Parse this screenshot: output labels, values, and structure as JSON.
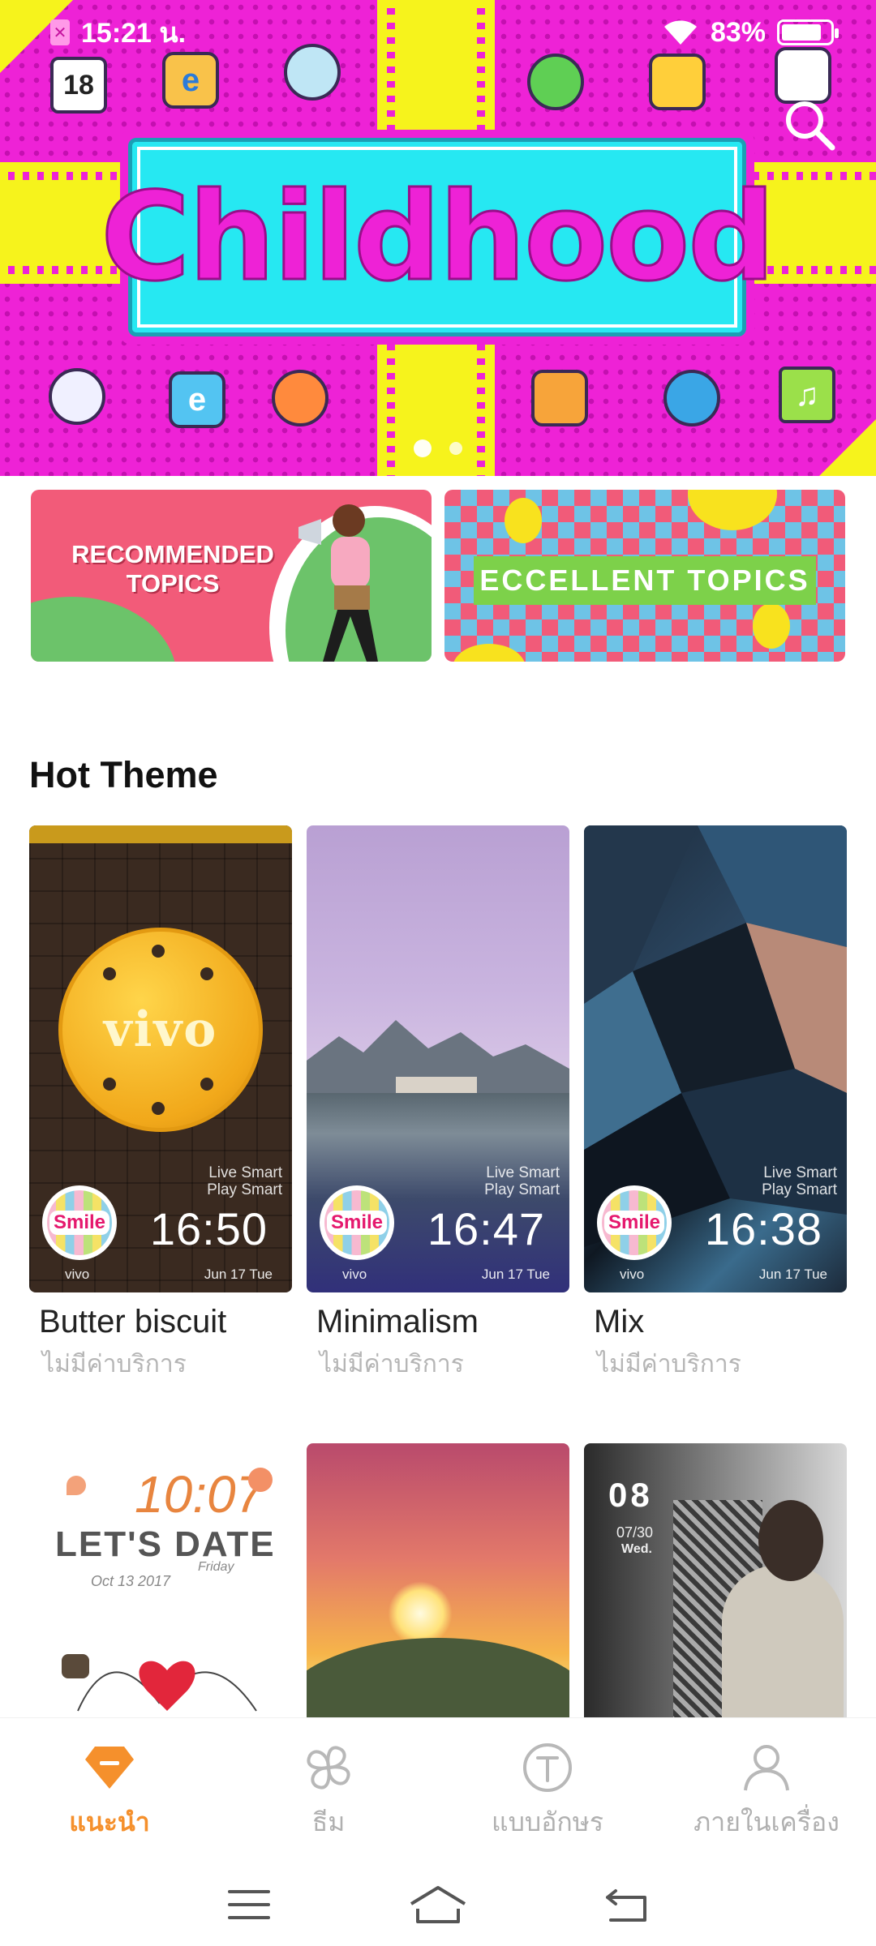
{
  "status_bar": {
    "time": "15:21 น.",
    "battery": "83%",
    "battery_level": 0.83
  },
  "banner": {
    "title": "Childhood",
    "page_count": 2,
    "active_page": 1
  },
  "topics": [
    {
      "label": "RECOMMENDED\nTOPICS"
    },
    {
      "label": "ECCELLENT  TOPICS"
    }
  ],
  "hot_theme": {
    "title": "Hot Theme",
    "items": [
      {
        "name": "Butter biscuit",
        "price": "ไม่มีค่าบริการ",
        "preview": {
          "brand": "vivo",
          "slogan1": "Live Smart",
          "slogan2": "Play Smart",
          "time": "16:50",
          "date": "Jun 17 Tue",
          "logo": "Smile",
          "cookie_text": "vivo"
        }
      },
      {
        "name": "Minimalism",
        "price": "ไม่มีค่าบริการ",
        "preview": {
          "brand": "vivo",
          "slogan1": "Live Smart",
          "slogan2": "Play Smart",
          "time": "16:47",
          "date": "Jun 17 Tue",
          "logo": "Smile"
        }
      },
      {
        "name": "Mix",
        "price": "ไม่มีค่าบริการ",
        "preview": {
          "brand": "vivo",
          "slogan1": "Live Smart",
          "slogan2": "Play Smart",
          "time": "16:38",
          "date": "Jun 17 Tue",
          "logo": "Smile"
        }
      },
      {
        "name": "",
        "price": "",
        "preview": {
          "time": "10:07",
          "headline": "LET'S DATE",
          "date": "Oct 13 2017",
          "day": "Friday"
        }
      },
      {
        "name": "",
        "price": "",
        "preview": {}
      },
      {
        "name": "",
        "price": "",
        "preview": {
          "time": "08",
          "date": "07/30",
          "day": "Wed."
        }
      }
    ]
  },
  "bottom_tabs": [
    {
      "label": "แนะนำ",
      "icon": "recommend-icon",
      "active": true
    },
    {
      "label": "ธีม",
      "icon": "theme-icon",
      "active": false
    },
    {
      "label": "แบบอักษร",
      "icon": "font-icon",
      "active": false
    },
    {
      "label": "ภายในเครื่อง",
      "icon": "local-icon",
      "active": false
    }
  ],
  "colors": {
    "accent": "#f5902c",
    "banner_magenta": "#ee22d6",
    "banner_yellow": "#f6f31c",
    "banner_cyan": "#26e8f2",
    "inactive": "#b0b0b0"
  }
}
